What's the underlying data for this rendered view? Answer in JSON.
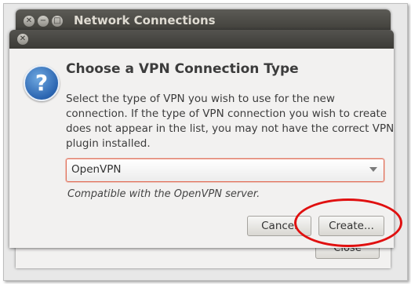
{
  "background_window": {
    "title": "Network Connections",
    "wm_buttons": [
      "close-icon",
      "minimize-icon",
      "maximize-icon"
    ],
    "close_button_label": "Close"
  },
  "dialog": {
    "heading": "Choose a VPN Connection Type",
    "description_lines": [
      "Select the type of VPN you wish to use for the new",
      "connection.  If the type of VPN connection you wish to create",
      "does not appear in the list, you may not have the correct VPN",
      "plugin installed."
    ],
    "vpn_type_select": {
      "selected": "OpenVPN"
    },
    "note": "Compatible with the OpenVPN server.",
    "cancel_label": "Cancel",
    "create_label": "Create..."
  },
  "colors": {
    "titlebar": "#3c3b37",
    "combo_focus_border": "#e2705a",
    "annotation": "#e01010",
    "question_icon": "#2a64b0"
  },
  "icons": {
    "question": "question-icon",
    "dropdown": "chevron-down-icon",
    "close": "close-icon"
  }
}
